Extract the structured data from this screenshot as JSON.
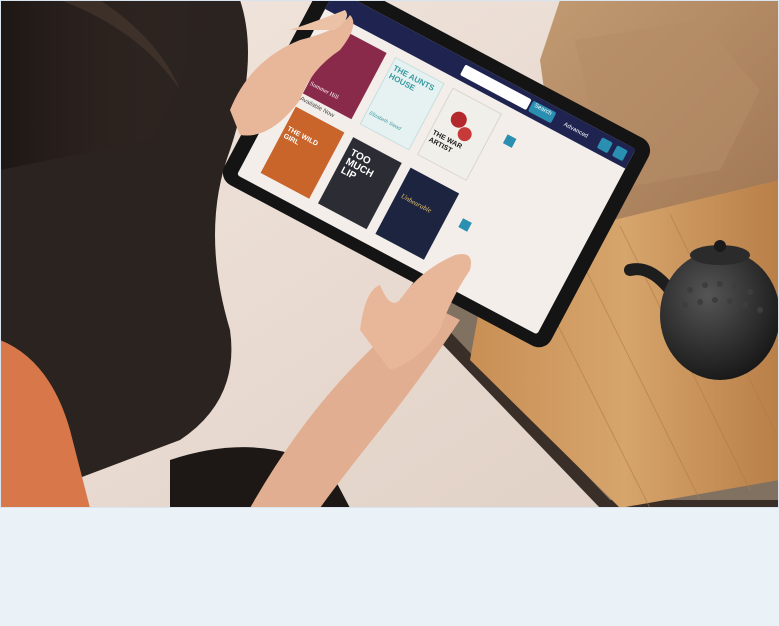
{
  "photo": {
    "subject": "person holding tablet showing library ebook catalog",
    "colors": {
      "bed_sheet": "#e9dcd3",
      "paper_bag": "#b89068",
      "bamboo_board": "#c9955e",
      "teapot": "#2a2a2a",
      "skin": "#e8b79a",
      "shirt": "#2b2320",
      "blanket": "#d8774a",
      "tablet_bezel": "#141414",
      "screen_bg": "#f3eeea",
      "header_navy": "#1e2350",
      "accent_teal": "#2a8fb0"
    }
  },
  "tablet_ui": {
    "search_button": "Search",
    "advanced_link": "Advanced",
    "section_heading": "Available Now",
    "books_top": [
      {
        "title": "Summer Hill",
        "cover": "#8a2a4a"
      },
      {
        "title": "THE AUNTS HOUSE",
        "author": "Elizabeth Stead",
        "cover": "#e6f2f2"
      },
      {
        "title": "THE WAR ARTIST",
        "cover": "#f0efe9"
      }
    ],
    "books_bottom": [
      {
        "title": "THE WILD GIRL",
        "cover": "#c9642a"
      },
      {
        "title": "TOO MUCH LIP",
        "cover": "#2c2c34"
      },
      {
        "title": "Unbearable",
        "cover": "#1c2440"
      }
    ]
  }
}
